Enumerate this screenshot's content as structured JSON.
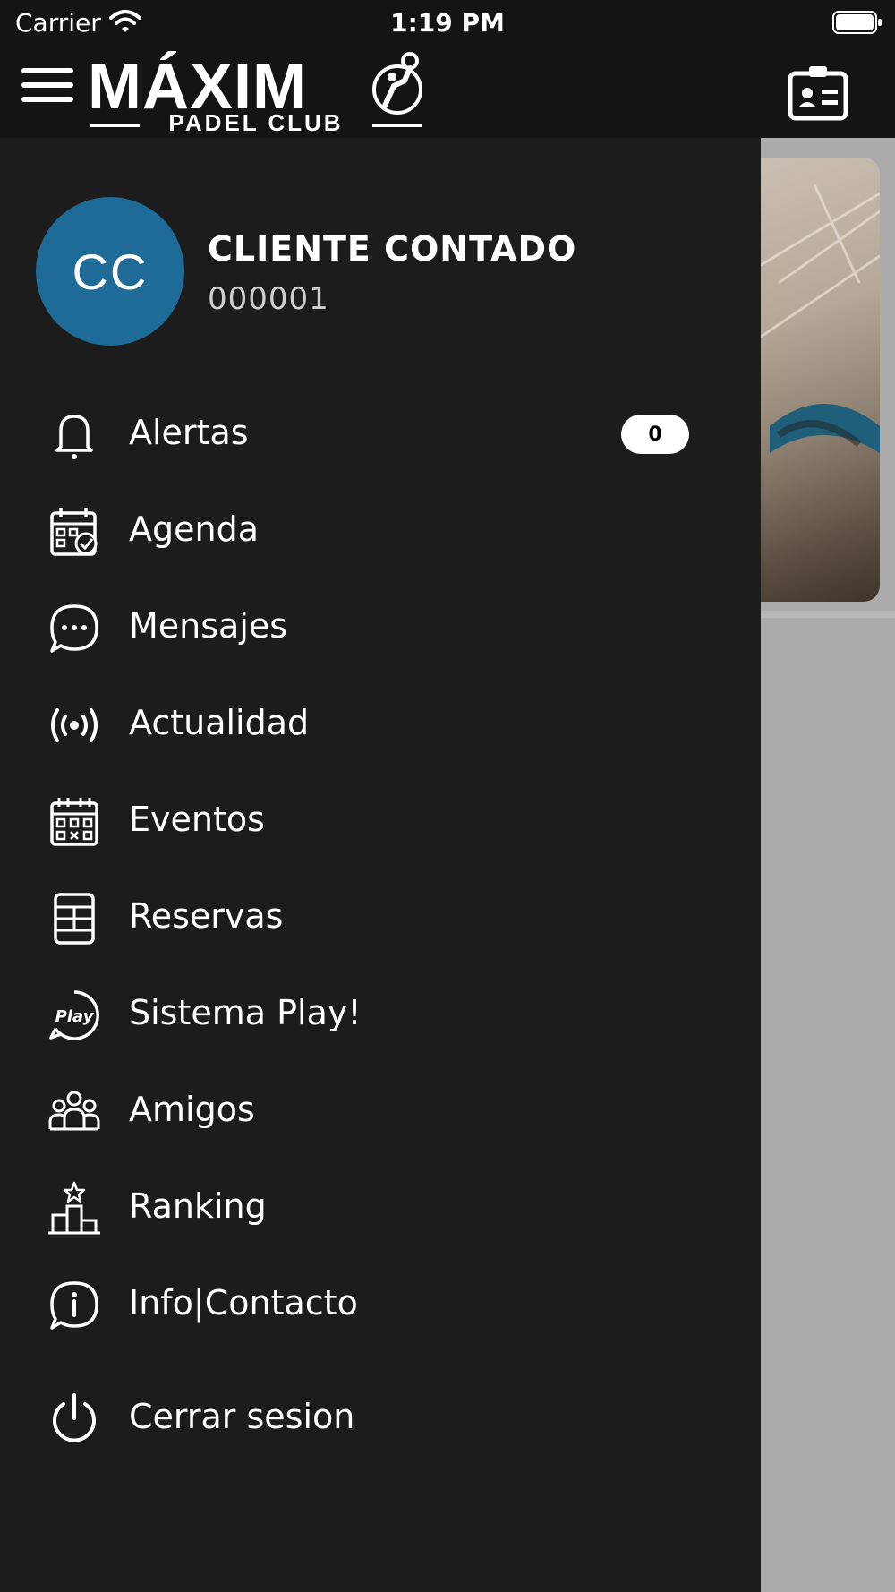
{
  "status_bar": {
    "carrier": "Carrier",
    "time": "1:19 PM"
  },
  "header": {
    "logo_main": "MÁXIM",
    "logo_sub": "PADEL CLUB"
  },
  "user": {
    "initials": "CC",
    "name": "CLIENTE CONTADO",
    "id": "000001"
  },
  "menu": {
    "items": [
      {
        "label": "Alertas",
        "icon": "bell-icon",
        "badge": "0"
      },
      {
        "label": "Agenda",
        "icon": "calendar-check-icon"
      },
      {
        "label": "Mensajes",
        "icon": "chat-bubble-icon"
      },
      {
        "label": "Actualidad",
        "icon": "broadcast-icon"
      },
      {
        "label": "Eventos",
        "icon": "calendar-grid-icon"
      },
      {
        "label": "Reservas",
        "icon": "court-icon"
      },
      {
        "label": "Sistema Play!",
        "icon": "play-badge-icon"
      },
      {
        "label": "Amigos",
        "icon": "friends-icon"
      },
      {
        "label": "Ranking",
        "icon": "podium-icon"
      },
      {
        "label": "Info|Contacto",
        "icon": "info-chat-icon"
      },
      {
        "label": "Cerrar sesion",
        "icon": "power-icon"
      }
    ]
  },
  "colors": {
    "avatar_bg": "#1e6b98",
    "drawer_bg": "#1c1c1d",
    "header_bg": "#141414"
  }
}
